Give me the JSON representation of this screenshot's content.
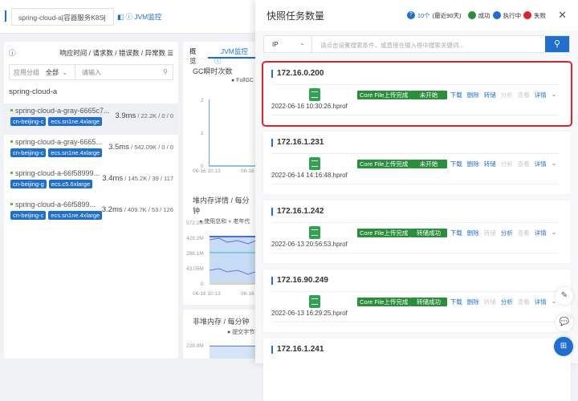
{
  "topbar": {
    "app_select": "spring-cloud-a[容器服务K8S]",
    "jvm_link": "JVM监控"
  },
  "left": {
    "metrics_header": "响应时间 / 请求数 / 错误数 / 异常数",
    "group_label": "应用分组",
    "group_value": "全部",
    "search_placeholder": "请输入",
    "app_name": "spring-cloud-a",
    "instances": [
      {
        "name": "spring-cloud-a-gray-6665c7...",
        "rt": "3.9ms",
        "rest": " / 22.2K / 0 / 0",
        "zone": "cn-beijing-c",
        "type": "ecs.sn1ne.4xlarge"
      },
      {
        "name": "spring-cloud-a-gray-6665...",
        "rt": "3.5ms",
        "rest": " / 542.09K / 0 / 0",
        "zone": "cn-beijing-c",
        "type": "ecs.sn1ne.4xlarge"
      },
      {
        "name": "spring-cloud-a-66f58999...",
        "rt": "3.4ms",
        "rest": " / 145.2K / 39 / 117",
        "zone": "cn-beijing-g",
        "type": "ecs.c5.6xlarge"
      },
      {
        "name": "spring-cloud-a-66f5899...",
        "rt": "3.2ms",
        "rest": " / 409.7K / 53 / 126",
        "zone": "cn-beijing-c",
        "type": "ecs.sn1ne.4xlarge"
      }
    ]
  },
  "middle": {
    "tabs": [
      "概览",
      "JVM监控"
    ],
    "gc_title": "GC瞬时次数",
    "gc_legend": "FullGC",
    "gc_y": [
      "2",
      "1",
      "0"
    ],
    "x_labels": [
      "06-16 10:13",
      "06-16 1"
    ],
    "heap_title": "堆内存详情 / 每分钟",
    "heap_legend": [
      "使用总和",
      "老年代"
    ],
    "heap_y": [
      "572.2M",
      "429.2M",
      "286.1M",
      "43.05M",
      "0"
    ],
    "heap_x": [
      "06-16 10:13",
      "06-16 10"
    ],
    "nonheap_title": "非堆内存 / 每分钟",
    "nonheap_legend": "提交字节数",
    "nonheap_y": "228.9M"
  },
  "drawer": {
    "title": "快照任务数量",
    "count": "10个",
    "range": "(最近90天)",
    "legend": [
      "成功",
      "执行中",
      "失败"
    ],
    "colors": {
      "success": "#2a8f3a",
      "running": "#1f6fd1",
      "fail": "#e0222b"
    },
    "search_type": "IP",
    "search_placeholder": "请点击设置搜索条件，或直接在输入框中搜索关键词...",
    "cards": [
      {
        "ip": "172.16.0.200",
        "file": "2022-06-16 10:30:26.hprof",
        "status1": "Core File上传完成",
        "status2": "未开始",
        "actions": [
          [
            "下载",
            1
          ],
          [
            "删除",
            1
          ],
          [
            "转储",
            1
          ],
          [
            "分析",
            0
          ],
          [
            "查看",
            0
          ],
          [
            "详情",
            1
          ]
        ]
      },
      {
        "ip": "172.16.1.231",
        "file": "2022-06-14 14:16:48.hprof",
        "status1": "Core File上传完成",
        "status2": "未开始",
        "actions": [
          [
            "下载",
            1
          ],
          [
            "删除",
            1
          ],
          [
            "转储",
            1
          ],
          [
            "分析",
            0
          ],
          [
            "查看",
            0
          ],
          [
            "详情",
            1
          ]
        ]
      },
      {
        "ip": "172.16.1.242",
        "file": "2022-06-13 20:56:53.hprof",
        "status1": "Core File上传完成",
        "status2": "转储成功",
        "actions": [
          [
            "下载",
            1
          ],
          [
            "删除",
            1
          ],
          [
            "转储",
            0
          ],
          [
            "分析",
            1
          ],
          [
            "查看",
            0
          ],
          [
            "详情",
            1
          ]
        ]
      },
      {
        "ip": "172.16.90.249",
        "file": "2022-06-13 16:29:25.hprof",
        "status1": "Core File上传完成",
        "status2": "转储成功",
        "actions": [
          [
            "下载",
            1
          ],
          [
            "删除",
            1
          ],
          [
            "转储",
            0
          ],
          [
            "分析",
            1
          ],
          [
            "查看",
            0
          ],
          [
            "详情",
            1
          ]
        ]
      },
      {
        "ip": "172.16.1.241"
      }
    ]
  }
}
